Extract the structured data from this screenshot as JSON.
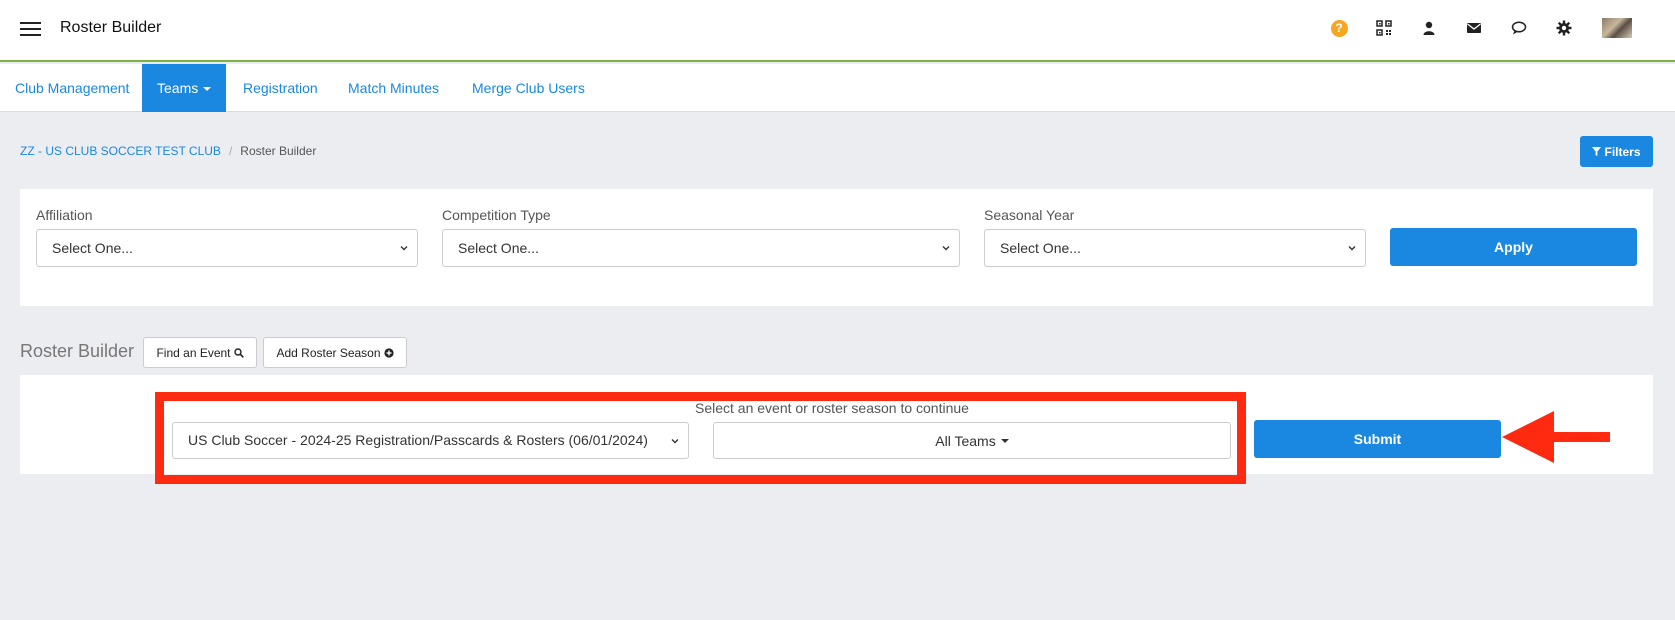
{
  "header": {
    "app_title": "Roster Builder",
    "help_glyph": "?",
    "icons": [
      "menu-icon",
      "help-icon",
      "qr-code-icon",
      "user-icon",
      "mail-icon",
      "chat-icon",
      "gear-icon"
    ]
  },
  "nav": {
    "items": [
      {
        "label": "Club Management",
        "active": false
      },
      {
        "label": "Teams",
        "active": true,
        "has_dropdown": true
      },
      {
        "label": "Registration",
        "active": false
      },
      {
        "label": "Match Minutes",
        "active": false
      },
      {
        "label": "Merge Club Users",
        "active": false
      }
    ]
  },
  "breadcrumb": {
    "club": "ZZ - US CLUB SOCCER TEST CLUB",
    "separator": "/",
    "current": "Roster Builder"
  },
  "filters_button": "Filters",
  "filter_panel": {
    "affiliation_label": "Affiliation",
    "affiliation_value": "Select One...",
    "competition_label": "Competition Type",
    "competition_value": "Select One...",
    "season_label": "Seasonal Year",
    "season_value": "Select One...",
    "apply_label": "Apply"
  },
  "roster_builder": {
    "heading": "Roster Builder",
    "find_event_label": "Find an Event",
    "add_season_label": "Add Roster Season",
    "prompt": "Select an event or roster season to continue",
    "event_value": "US Club Soccer - 2024-25 Registration/Passcards & Rosters (06/01/2024)",
    "teams_value": "All Teams",
    "submit_label": "Submit"
  },
  "colors": {
    "primary": "#1a88e0",
    "highlight": "#ff2a0f",
    "header_border": "#7cb342",
    "help": "#f5a623"
  }
}
